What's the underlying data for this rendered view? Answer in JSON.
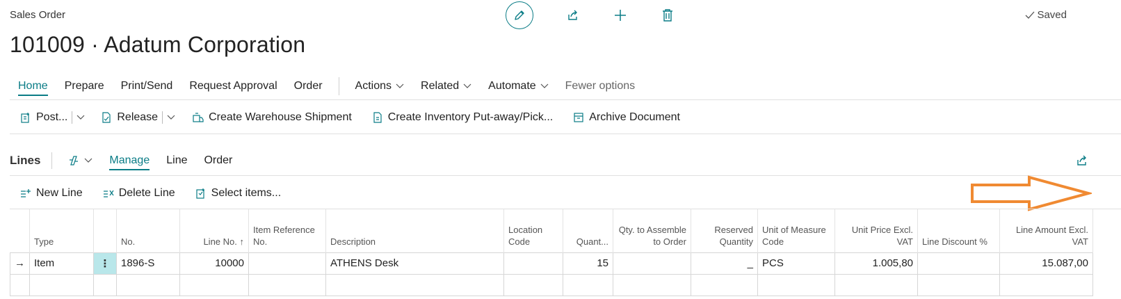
{
  "header": {
    "caption": "Sales Order",
    "title": "101009 · Adatum Corporation",
    "saved_label": "Saved"
  },
  "tabs": {
    "items": [
      "Home",
      "Prepare",
      "Print/Send",
      "Request Approval",
      "Order"
    ],
    "menus": [
      "Actions",
      "Related",
      "Automate"
    ],
    "fewer": "Fewer options"
  },
  "actions": {
    "post": "Post...",
    "release": "Release",
    "create_shipment": "Create Warehouse Shipment",
    "create_putaway": "Create Inventory Put-away/Pick...",
    "archive": "Archive Document"
  },
  "lines": {
    "title": "Lines",
    "tabs": [
      "Manage",
      "Line",
      "Order"
    ],
    "new_line": "New Line",
    "delete_line": "Delete Line",
    "select_items": "Select items..."
  },
  "table": {
    "headers": {
      "type": "Type",
      "no": "No.",
      "line_no": "Line No. ↑",
      "item_ref": "Item Reference No.",
      "description": "Description",
      "location": "Location Code",
      "quantity": "Quant...",
      "qty_assemble": "Qty. to Assemble to Order",
      "reserved": "Reserved Quantity",
      "uom": "Unit of Measure Code",
      "unit_price": "Unit Price Excl. VAT",
      "line_discount": "Line Discount %",
      "line_amount": "Line Amount Excl. VAT"
    },
    "rows": [
      {
        "marker": "→",
        "type": "Item",
        "menu": "⋮",
        "no": "1896-S",
        "line_no": "10000",
        "item_ref": "",
        "description": "ATHENS Desk",
        "location": "",
        "quantity": "15",
        "qty_assemble": "",
        "reserved": "_",
        "uom": "PCS",
        "unit_price": "1.005,80",
        "line_discount": "",
        "line_amount": "15.087,00"
      }
    ]
  },
  "colors": {
    "accent": "#0a7c86",
    "annotation_arrow": "#f08a32",
    "selected_cell": "#b9e7ea"
  }
}
